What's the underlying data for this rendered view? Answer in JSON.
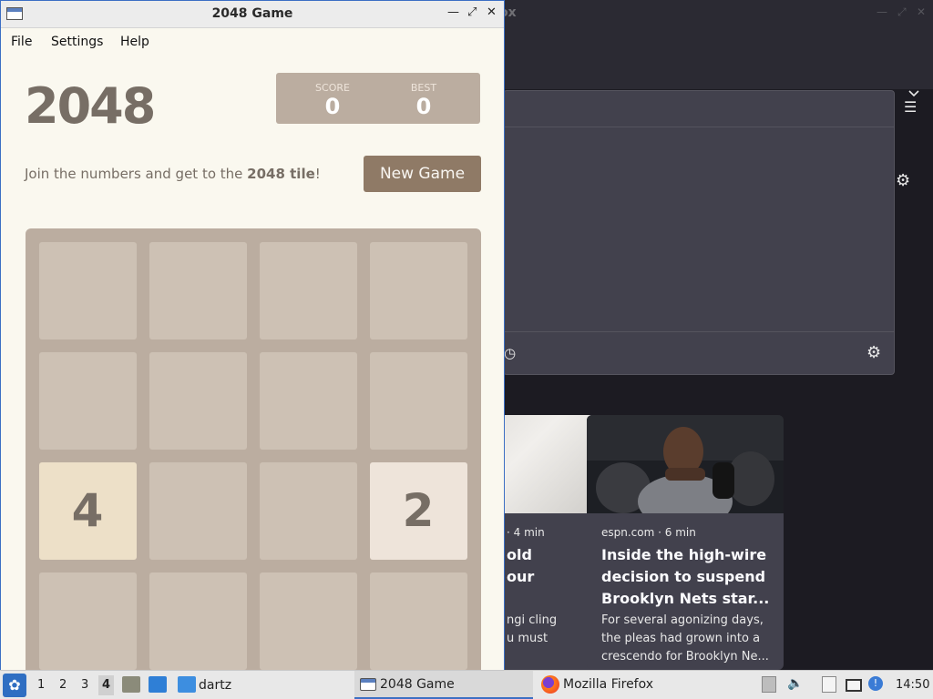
{
  "colors": {
    "board": "#bbada0",
    "empty_cell": "#cdc1b4",
    "tile_2": "#eee4da",
    "tile_4": "#ede0c8",
    "new_game_button": "#8f7a66",
    "selection_border": "#3c6fc4"
  },
  "firefox": {
    "window_title": "ox",
    "icons": [
      "chevron-down-icon",
      "hamburger-menu-icon",
      "gear-icon",
      "history-icon",
      "gear-icon"
    ],
    "cards": [
      {
        "source": "· 4 min",
        "headline": "old\nour",
        "excerpt": "ngi cling\nu must"
      },
      {
        "source": "espn.com · 6 min",
        "headline": "Inside the high-wire decision to suspend Brooklyn Nets star...",
        "excerpt": "For several agonizing days, the pleas had grown into a crescendo for Brooklyn Ne..."
      }
    ]
  },
  "game": {
    "window_title": "2048 Game",
    "menu": [
      "File",
      "Settings",
      "Help"
    ],
    "heading": "2048",
    "score": {
      "label": "SCORE",
      "value": "0"
    },
    "best": {
      "label": "BEST",
      "value": "0"
    },
    "intro_prefix": "Join the numbers and get to the ",
    "intro_bold": "2048 tile",
    "intro_suffix": "!",
    "new_game_label": "New Game",
    "grid": [
      [
        "",
        "",
        "",
        ""
      ],
      [
        "",
        "",
        "",
        ""
      ],
      [
        "4",
        "",
        "",
        "2"
      ],
      [
        "",
        "",
        "",
        ""
      ]
    ]
  },
  "taskbar": {
    "workspaces": [
      "1",
      "2",
      "3",
      "4"
    ],
    "active_workspace": "4",
    "folder_label": "dartz",
    "tasks": [
      {
        "label": "2048 Game",
        "icon": "window-icon",
        "active": true
      },
      {
        "label": "Mozilla Firefox",
        "icon": "firefox-icon",
        "active": false
      }
    ],
    "tray_icons": [
      "upload-icon",
      "volume-icon",
      "clipboard-icon",
      "network-icon",
      "update-icon"
    ],
    "clock": "14:50"
  }
}
